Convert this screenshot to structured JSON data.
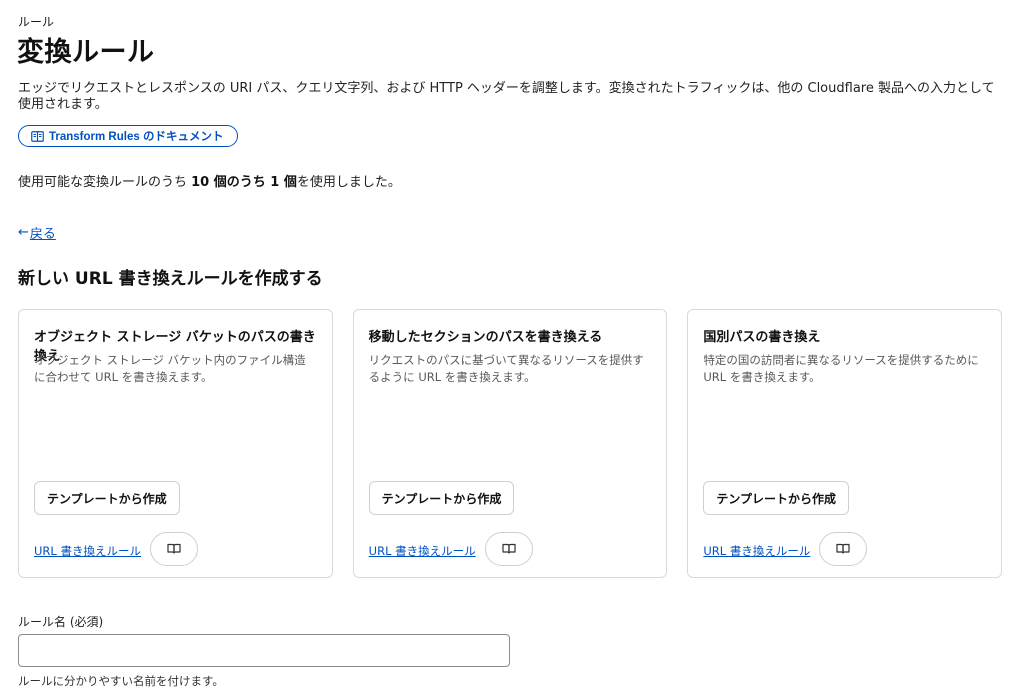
{
  "header": {
    "breadcrumb": "ルール",
    "title": "変換ルール",
    "description": "エッジでリクエストとレスポンスの URI パス、クエリ文字列、および HTTP ヘッダーを調整します。変換されたトラフィックは、他の Cloudflare 製品への入力として使用されます。",
    "doc_button_label": "Transform Rules のドキュメント",
    "usage": {
      "prefix": "使用可能な変換ルールのうち ",
      "bold": "10 個のうち 1 個",
      "suffix": "を使用しました。"
    }
  },
  "nav": {
    "back_arrow": "←",
    "back_label": "戻る"
  },
  "section_title": "新しい URL 書き換えルールを作成する",
  "cards": [
    {
      "title": "オブジェクト ストレージ バケットのパスの書き換え",
      "description": "オブジェクト ストレージ バケット内のファイル構造に合わせて URL を書き換えます。",
      "button_label": "テンプレートから作成",
      "link_label": "URL 書き換えルール",
      "icon": "book-icon"
    },
    {
      "title": "移動したセクションのパスを書き換える",
      "description": "リクエストのパスに基づいて異なるリソースを提供するように URL を書き換えます。",
      "button_label": "テンプレートから作成",
      "link_label": "URL 書き換えルール",
      "icon": "book-icon"
    },
    {
      "title": "国別パスの書き換え",
      "description": "特定の国の訪問者に異なるリソースを提供するために URL を書き換えます。",
      "button_label": "テンプレートから作成",
      "link_label": "URL 書き換えルール",
      "icon": "book-icon"
    }
  ],
  "form": {
    "rule_name_label": "ルール名 (必須)",
    "rule_name_value": "",
    "rule_name_placeholder": "",
    "rule_name_help": "ルールに分かりやすい名前を付けます。"
  },
  "colors": {
    "accent": "#0051c3",
    "card_border": "#d9d9d9",
    "muted_text": "#595959"
  }
}
